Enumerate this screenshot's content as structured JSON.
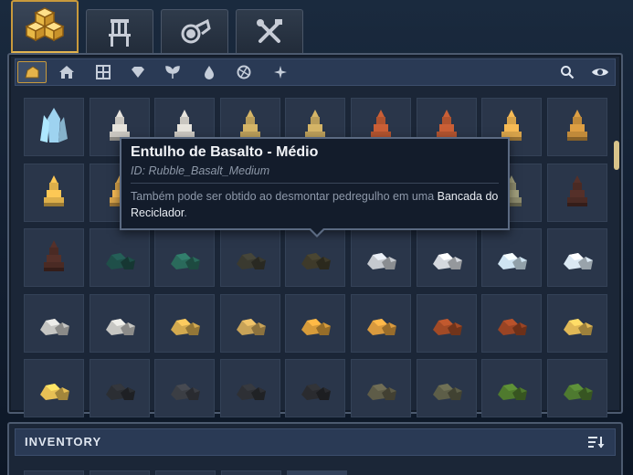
{
  "category_tabs": [
    {
      "icon": "blocks-icon",
      "active": true
    },
    {
      "icon": "furniture-icon",
      "active": false
    },
    {
      "icon": "potion-icon",
      "active": false
    },
    {
      "icon": "tools-icon",
      "active": false
    }
  ],
  "filters": [
    {
      "icon": "rock-icon",
      "active": true
    },
    {
      "icon": "house-icon"
    },
    {
      "icon": "window-icon"
    },
    {
      "icon": "gem-icon"
    },
    {
      "icon": "plant-icon"
    },
    {
      "icon": "drop-icon"
    },
    {
      "icon": "globe-icon"
    },
    {
      "icon": "sparkle-icon"
    }
  ],
  "colors": {
    "accent": "#c99a3c",
    "panel_bg": "#1b2637",
    "slot_bg": "#2a364a"
  },
  "tooltip": {
    "title": "Entulho de Basalto - Médio",
    "id": "ID: Rubble_Basalt_Medium",
    "desc_prefix": "Também pode ser obtido ao desmontar pedregulho em uma ",
    "desc_highlight": "Bancada do Reciclador",
    "desc_suffix": "."
  },
  "inventory": {
    "title": "INVENTORY"
  },
  "items": [
    [
      "ice",
      "#9ed3f0"
    ],
    [
      "stalag",
      "#c9c6c0"
    ],
    [
      "stalag",
      "#c9c6c0"
    ],
    [
      "stalag",
      "#b99d5a"
    ],
    [
      "stalag",
      "#b99d5a"
    ],
    [
      "stalag",
      "#b0532f"
    ],
    [
      "stalag",
      "#b0532f"
    ],
    [
      "stalag",
      "#d6a24a"
    ],
    [
      "stalag",
      "#c08a3a"
    ],
    [
      "stalag",
      "#dcae4a"
    ],
    [
      "stalag",
      "#d6a24a"
    ],
    [
      "none",
      ""
    ],
    [
      "none",
      ""
    ],
    [
      "none",
      ""
    ],
    [
      "none",
      ""
    ],
    [
      "none",
      ""
    ],
    [
      "stalag",
      "#8c8a6c"
    ],
    [
      "stalag",
      "#4a2a24"
    ],
    [
      "stalag",
      "#4a2a24"
    ],
    [
      "rock",
      "#1f4f49"
    ],
    [
      "rock",
      "#2a6a5b"
    ],
    [
      "rock",
      "#3a3a30"
    ],
    [
      "rock",
      "#3e3a2a"
    ],
    [
      "rock",
      "#c5c9cf"
    ],
    [
      "rock",
      "#d5d9df"
    ],
    [
      "rock",
      "#cfe4f2"
    ],
    [
      "rock",
      "#dbe9f4"
    ],
    [
      "rock",
      "#c5c5c2"
    ],
    [
      "rock",
      "#c7c7c3"
    ],
    [
      "rock",
      "#d2a94f"
    ],
    [
      "rock",
      "#c8a358"
    ],
    [
      "rock",
      "#d69b3a"
    ],
    [
      "rock",
      "#d99a3e"
    ],
    [
      "rock",
      "#a24a26"
    ],
    [
      "rock",
      "#9a4424"
    ],
    [
      "rock",
      "#e0b856"
    ],
    [
      "rock",
      "#e7c055"
    ],
    [
      "rock",
      "#2b2e33"
    ],
    [
      "rock",
      "#3b3e44"
    ],
    [
      "rock",
      "#2e3035"
    ],
    [
      "rock",
      "#2a2b2f"
    ],
    [
      "rock",
      "#5e5c48"
    ],
    [
      "rock",
      "#5d5e48"
    ],
    [
      "rock",
      "#4f7a2e"
    ],
    [
      "rock",
      "#4e7a30"
    ]
  ]
}
